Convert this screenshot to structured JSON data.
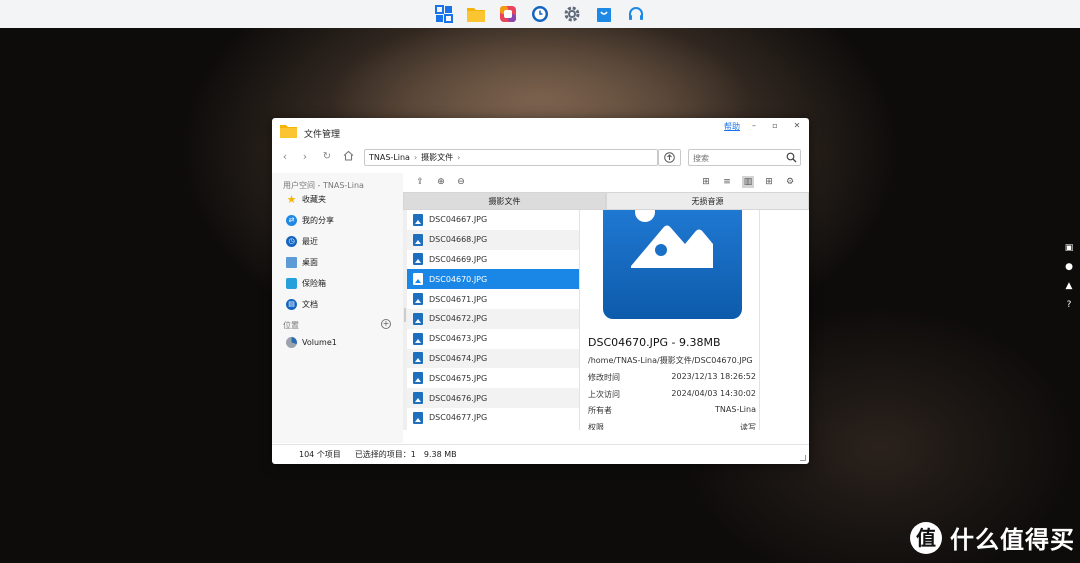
{
  "taskbar": {
    "apps": [
      {
        "name": "app-center-icon",
        "color": "#1a73e8"
      },
      {
        "name": "file-manager-icon",
        "color": "#f4b400"
      },
      {
        "name": "photos-icon",
        "color": "#e8445a"
      },
      {
        "name": "backup-clock-icon",
        "color": "#1565c0"
      },
      {
        "name": "settings-gear-icon",
        "color": "#5f6b7a"
      },
      {
        "name": "store-bag-icon",
        "color": "#1e88e5"
      },
      {
        "name": "support-headset-icon",
        "color": "#1e88e5"
      }
    ]
  },
  "window": {
    "title": "文件管理",
    "help": "帮助",
    "path": [
      "TNAS-Lina",
      "摄影文件"
    ],
    "search_placeholder": "搜索"
  },
  "sidebar": {
    "user_space_header": "用户空间 - TNAS-Lina",
    "items": [
      {
        "label": "收藏夹",
        "icon": "star-icon",
        "color": "#f4b400"
      },
      {
        "label": "我的分享",
        "icon": "share-icon",
        "color": "#1e88e5"
      },
      {
        "label": "最近",
        "icon": "recent-icon",
        "color": "#1565c0"
      },
      {
        "label": "桌面",
        "icon": "desktop-icon",
        "color": "#5c9bd6"
      },
      {
        "label": "保险箱",
        "icon": "safe-box-icon",
        "color": "#26a0da"
      },
      {
        "label": "文档",
        "icon": "document-icon",
        "color": "#1565c0"
      }
    ],
    "location_header": "位置",
    "volumes": [
      {
        "label": "Volume1",
        "icon": "volume-disk-icon"
      }
    ]
  },
  "tabs": [
    {
      "label": "摄影文件",
      "active": true
    },
    {
      "label": "无损音源",
      "active": false
    }
  ],
  "files": [
    {
      "name": "DSC04667.JPG"
    },
    {
      "name": "DSC04668.JPG"
    },
    {
      "name": "DSC04669.JPG"
    },
    {
      "name": "DSC04670.JPG",
      "selected": true
    },
    {
      "name": "DSC04671.JPG"
    },
    {
      "name": "DSC04672.JPG"
    },
    {
      "name": "DSC04673.JPG"
    },
    {
      "name": "DSC04674.JPG"
    },
    {
      "name": "DSC04675.JPG"
    },
    {
      "name": "DSC04676.JPG"
    },
    {
      "name": "DSC04677.JPG"
    }
  ],
  "preview": {
    "title": "DSC04670.JPG - 9.38MB",
    "path": "/home/TNAS-Lina/摄影文件/DSC04670.JPG",
    "meta": [
      {
        "key": "修改时间",
        "value": "2023/12/13 18:26:52"
      },
      {
        "key": "上次访问",
        "value": "2024/04/03 14:30:02"
      },
      {
        "key": "所有者",
        "value": "TNAS-Lina"
      },
      {
        "key": "权限",
        "value": "读写"
      }
    ]
  },
  "status": {
    "count": "104 个项目",
    "selected": "已选择的项目：1",
    "size": "9.38 MB"
  },
  "watermark": {
    "badge": "值",
    "text": "什么值得买"
  }
}
